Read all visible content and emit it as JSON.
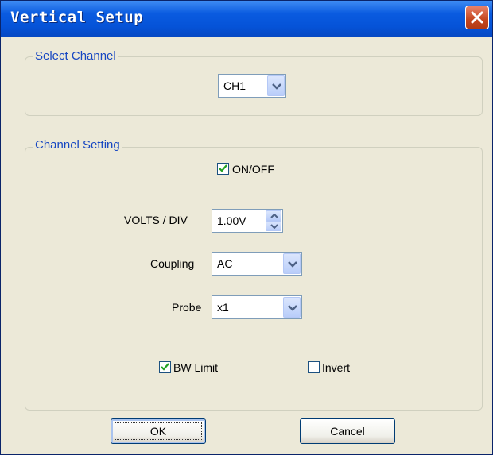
{
  "window": {
    "title": "Vertical Setup"
  },
  "select_channel": {
    "group_label": "Select Channel",
    "channel_value": "CH1"
  },
  "channel_setting": {
    "group_label": "Channel Setting",
    "on_off": {
      "label": "ON/OFF",
      "checked": true
    },
    "volts_div": {
      "label": "VOLTS / DIV",
      "value": "1.00V"
    },
    "coupling": {
      "label": "Coupling",
      "value": "AC"
    },
    "probe": {
      "label": "Probe",
      "value": "x1"
    },
    "bw_limit": {
      "label": "BW Limit",
      "checked": true
    },
    "invert": {
      "label": "Invert",
      "checked": false
    }
  },
  "buttons": {
    "ok": "OK",
    "cancel": "Cancel"
  },
  "colors": {
    "title_bar": "#0553d8",
    "group_label": "#1747c2",
    "close": "#c4461f",
    "dialog_bg": "#ece9d8"
  },
  "icons": {
    "close": "close-icon",
    "dropdown": "chevron-down-icon",
    "spin": "spin-arrows-icon",
    "check": "check-icon"
  }
}
